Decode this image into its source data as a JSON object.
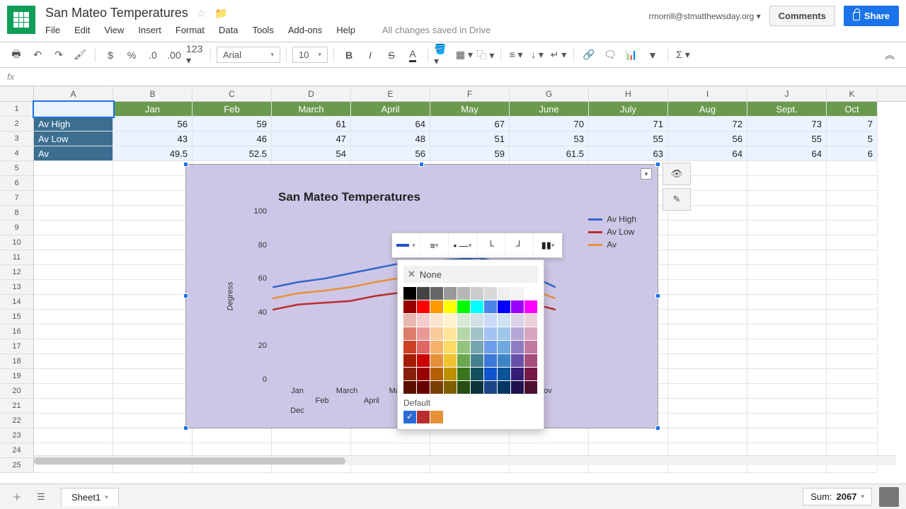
{
  "doc_title": "San Mateo Temperatures",
  "account_email": "rmorrill@stmatthewsday.org",
  "menus": [
    "File",
    "Edit",
    "View",
    "Insert",
    "Format",
    "Data",
    "Tools",
    "Add-ons",
    "Help"
  ],
  "save_status": "All changes saved in Drive",
  "comments_btn": "Comments",
  "share_btn": "Share",
  "font_name": "Arial",
  "font_size": "10",
  "col_letters": [
    "A",
    "B",
    "C",
    "D",
    "E",
    "F",
    "G",
    "H",
    "I",
    "J",
    "K"
  ],
  "months": [
    "Jan",
    "Feb",
    "March",
    "April",
    "May",
    "June",
    "July",
    "Aug",
    "Sept.",
    "Oct"
  ],
  "row_labels": [
    "Av High",
    "Av Low",
    "Av"
  ],
  "data_rows": {
    "Av High": [
      "56",
      "59",
      "61",
      "64",
      "67",
      "70",
      "71",
      "72",
      "73",
      "7"
    ],
    "Av Low": [
      "43",
      "46",
      "47",
      "48",
      "51",
      "53",
      "55",
      "56",
      "55",
      "5"
    ],
    "Av": [
      "49.5",
      "52.5",
      "54",
      "56",
      "59",
      "61.5",
      "63",
      "64",
      "64",
      "6"
    ]
  },
  "chart_title": "San Mateo Temperatures",
  "y_ticks": [
    "100",
    "80",
    "60",
    "40",
    "20",
    "0"
  ],
  "y_axis_label": "Degress",
  "x_ticks_row1": [
    "Jan",
    "March",
    "May",
    "July",
    "Sept.",
    "Nov"
  ],
  "x_ticks_row2": [
    "Feb",
    "April",
    "June",
    "Aug",
    "Oct",
    "Dec"
  ],
  "legend": [
    {
      "name": "Av High",
      "color": "#3366cc"
    },
    {
      "name": "Av Low",
      "color": "#b82e2e"
    },
    {
      "name": "Av",
      "color": "#e69138"
    }
  ],
  "chart_data": {
    "type": "line",
    "title": "San Mateo Temperatures",
    "ylabel": "Degress",
    "ylim": [
      0,
      100
    ],
    "categories": [
      "Jan",
      "Feb",
      "March",
      "April",
      "May",
      "June",
      "July",
      "Aug",
      "Sept.",
      "Oct",
      "Nov",
      "Dec"
    ],
    "series": [
      {
        "name": "Av High",
        "color": "#3366cc",
        "values": [
          56,
          59,
          61,
          64,
          67,
          70,
          71,
          72,
          73,
          70,
          63,
          56
        ]
      },
      {
        "name": "Av Low",
        "color": "#b82e2e",
        "values": [
          43,
          46,
          47,
          48,
          51,
          53,
          55,
          56,
          55,
          51,
          47,
          43
        ]
      },
      {
        "name": "Av",
        "color": "#e69138",
        "values": [
          49.5,
          52.5,
          54,
          56,
          59,
          61.5,
          63,
          64,
          64,
          60.5,
          55,
          49.5
        ]
      }
    ]
  },
  "popup_none": "None",
  "popup_default_label": "Default",
  "popup_palette_rows": [
    [
      "#000000",
      "#434343",
      "#666666",
      "#999999",
      "#b7b7b7",
      "#cccccc",
      "#d9d9d9",
      "#efefef",
      "#f3f3f3",
      "#ffffff"
    ],
    [
      "#980000",
      "#ff0000",
      "#ff9900",
      "#ffff00",
      "#00ff00",
      "#00ffff",
      "#4a86e8",
      "#0000ff",
      "#9900ff",
      "#ff00ff"
    ],
    [
      "#e6b8af",
      "#f4cccc",
      "#fce5cd",
      "#fff2cc",
      "#d9ead3",
      "#d0e0e3",
      "#c9daf8",
      "#cfe2f3",
      "#d9d2e9",
      "#ead1dc"
    ],
    [
      "#dd7e6b",
      "#ea9999",
      "#f9cb9c",
      "#ffe599",
      "#b6d7a8",
      "#a2c4c9",
      "#a4c2f4",
      "#9fc5e8",
      "#b4a7d6",
      "#d5a6bd"
    ],
    [
      "#cc4125",
      "#e06666",
      "#f6b26b",
      "#ffd966",
      "#93c47d",
      "#76a5af",
      "#6d9eeb",
      "#6fa8dc",
      "#8e7cc3",
      "#c27ba0"
    ],
    [
      "#a61c00",
      "#cc0000",
      "#e69138",
      "#f1c232",
      "#6aa84f",
      "#45818e",
      "#3c78d8",
      "#3d85c6",
      "#674ea7",
      "#a64d79"
    ],
    [
      "#85200c",
      "#990000",
      "#b45f06",
      "#bf9000",
      "#38761d",
      "#134f5c",
      "#1155cc",
      "#0b5394",
      "#351c75",
      "#741b47"
    ],
    [
      "#5b0f00",
      "#660000",
      "#783f04",
      "#7f6000",
      "#274e13",
      "#0c343d",
      "#1c4587",
      "#073763",
      "#20124d",
      "#4c1130"
    ]
  ],
  "popup_defaults": [
    "#3366cc",
    "#b82e2e",
    "#e69138"
  ],
  "sheet_tab": "Sheet1",
  "sum_label": "Sum:",
  "sum_value": "2067"
}
